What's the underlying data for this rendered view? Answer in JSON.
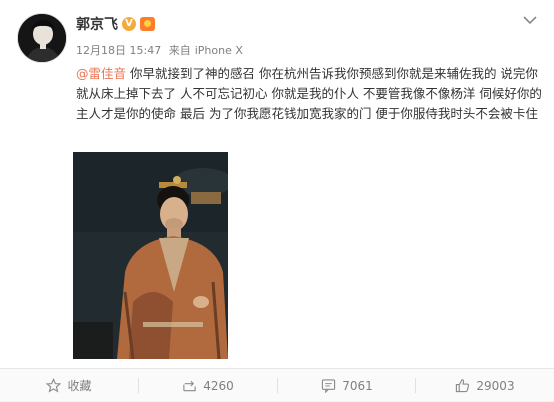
{
  "post": {
    "author": "郭京飞",
    "verified_badge": "V",
    "timestamp": "12月18日 15:47",
    "source_prefix": "来自",
    "source": "iPhone X",
    "mention": "@雷佳音",
    "text": " 你早就接到了神的感召 你在杭州告诉我你预感到你就是来辅佐我的 说完你就从床上掉下去了 人不可忘记初心 你就是我的仆人 不要管我像不像杨洋 伺候好你的主人才是你的使命 最后 为了你我愿花钱加宽我家的门 便于你服侍我时头不会被卡住"
  },
  "actions": {
    "favorite_label": "收藏",
    "repost_count": "4260",
    "comment_count": "7061",
    "like_count": "29003"
  },
  "colors": {
    "mention": "#eb7350",
    "meta": "#808080",
    "verified": "#f3ab3e"
  },
  "icons": {
    "favorite": "star-icon",
    "repost": "repost-icon",
    "comment": "comment-icon",
    "like": "thumbs-up-icon",
    "menu": "chevron-down-icon"
  }
}
